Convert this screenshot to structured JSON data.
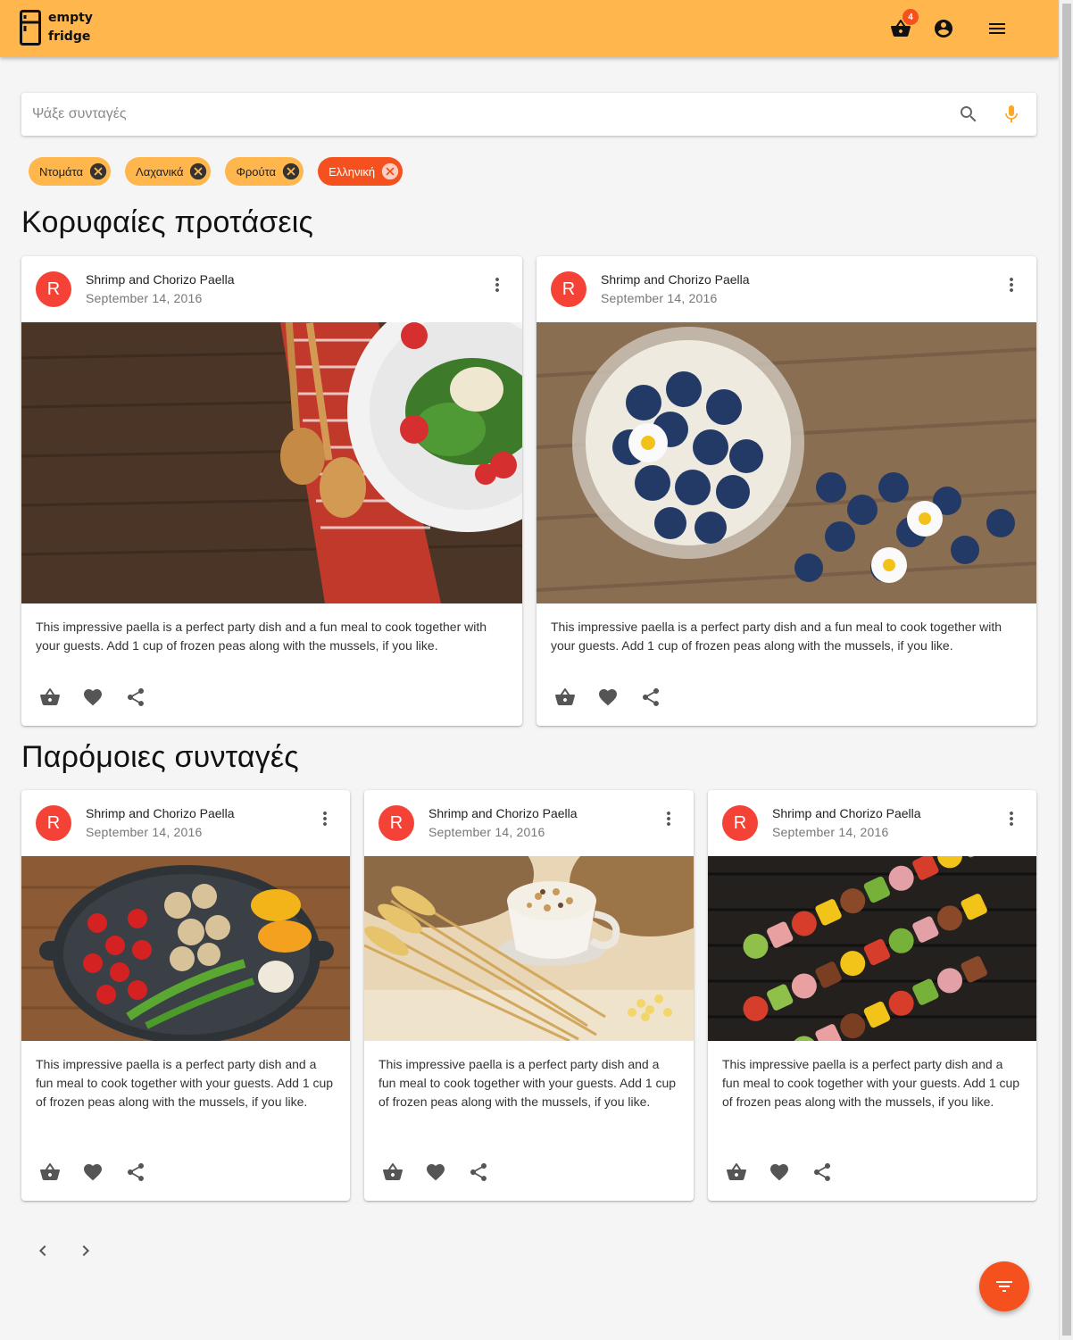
{
  "app": {
    "logo_line1": "empty",
    "logo_line2": "fridge",
    "cart_count": "4"
  },
  "search": {
    "placeholder": "Ψάξε συνταγές"
  },
  "chips": [
    {
      "label": "Ντομάτα",
      "active": false
    },
    {
      "label": "Λαχανικά",
      "active": false
    },
    {
      "label": "Φρούτα",
      "active": false
    },
    {
      "label": "Ελληνική",
      "active": true
    }
  ],
  "sections": {
    "top": "Κορυφαίες προτάσεις",
    "similar": "Παρόμοιες συνταγές"
  },
  "top_cards": [
    {
      "avatar": "R",
      "title": "Shrimp and Chorizo Paella",
      "date": "September 14, 2016",
      "text": "This impressive paella is a perfect party dish and a fun meal to cook together with your guests. Add 1 cup of frozen peas along with the mussels, if you like.",
      "image": "salad-spoons"
    },
    {
      "avatar": "R",
      "title": "Shrimp and Chorizo Paella",
      "date": "September 14, 2016",
      "text": "This impressive paella is a perfect party dish and a fun meal to cook together with your guests. Add 1 cup of frozen peas along with the mussels, if you like.",
      "image": "blueberries"
    }
  ],
  "similar_cards": [
    {
      "avatar": "R",
      "title": "Shrimp and Chorizo Paella",
      "date": "September 14, 2016",
      "text": "This impressive paella is a perfect party dish and a fun meal to cook together with your guests. Add 1 cup of frozen peas along with the mussels, if you like.",
      "image": "vegetable-pan"
    },
    {
      "avatar": "R",
      "title": "Shrimp and Chorizo Paella",
      "date": "September 14, 2016",
      "text": "This impressive paella is a perfect party dish and a fun meal to cook together with your guests. Add 1 cup of frozen peas along with the mussels, if you like.",
      "image": "cereal-wheat"
    },
    {
      "avatar": "R",
      "title": "Shrimp and Chorizo Paella",
      "date": "September 14, 2016",
      "text": "This impressive paella is a perfect party dish and a fun meal to cook together with your guests. Add 1 cup of frozen peas along with the mussels, if you like.",
      "image": "skewers"
    }
  ],
  "colors": {
    "appbar": "#ffb74d",
    "accent": "#f4511e",
    "avatar": "#f44336",
    "mic": "#ffa726"
  },
  "icons": {
    "cart": "basket-icon",
    "account": "account-circle-icon",
    "menu": "menu-icon",
    "search": "search-icon",
    "mic": "mic-icon",
    "more": "more-vert-icon",
    "like": "heart-icon",
    "share": "share-icon",
    "prev": "chevron-left-icon",
    "next": "chevron-right-icon",
    "fab": "filter-icon"
  }
}
